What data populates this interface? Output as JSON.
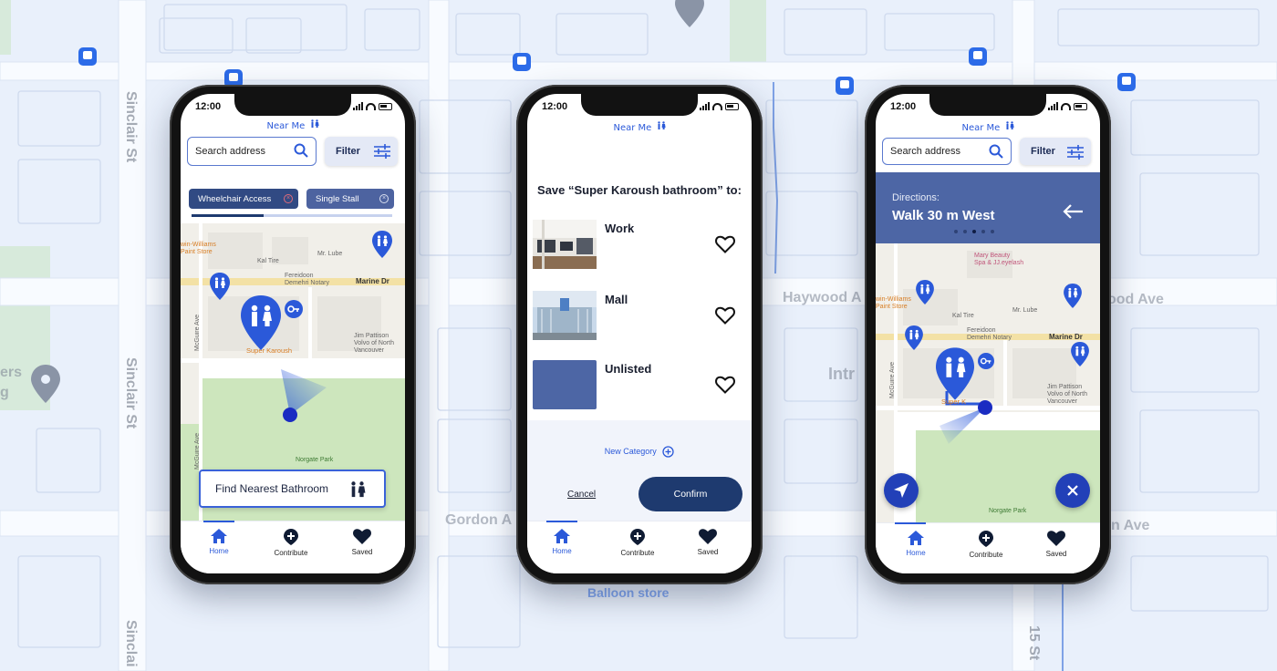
{
  "background": {
    "streets": [
      "Sinclair St",
      "Sinclair St",
      "Sinclai",
      "Haywood A",
      "ood Ave",
      "Gordon A",
      "n Ave",
      "Intr",
      "15 St",
      "ers",
      "g",
      "Balloon store"
    ]
  },
  "phone1": {
    "time": "12:00",
    "brand": "Near Me",
    "search_placeholder": "Search address",
    "filter_label": "Filter",
    "chips": [
      "Wheelchair Access",
      "Single Stall"
    ],
    "map_labels": {
      "store": "win-Williams\nPaint Store",
      "kaltire": "Kal Tire",
      "mrlube": "Mr. Lube",
      "notary": "Fereidoon\nDemehri Notary",
      "road": "Marine Dr",
      "mcguire": "McGuire Ave",
      "mcguire2": "McGuire Ave",
      "volvo": "Jim Pattison\nVolvo of North\nVancouver",
      "super": "Super Karoush",
      "park": "Norgate Park"
    },
    "find_button": "Find Nearest Bathroom",
    "nav": [
      "Home",
      "Contribute",
      "Saved"
    ]
  },
  "phone2": {
    "time": "12:00",
    "brand": "Near Me",
    "save_title": "Save “Super Karoush bathroom” to:",
    "categories": [
      "Work",
      "Mall",
      "Unlisted"
    ],
    "new_category": "New Category",
    "cancel": "Cancel",
    "confirm": "Confirm",
    "nav": [
      "Home",
      "Contribute",
      "Saved"
    ]
  },
  "phone3": {
    "time": "12:00",
    "brand": "Near Me",
    "search_placeholder": "Search address",
    "filter_label": "Filter",
    "directions_label": "Directions:",
    "directions_text": "Walk 30 m West",
    "map_labels": {
      "marybeauty": "Mary Beauty\nSpa & JJ.eyelash",
      "store": "win-Williams\nPaint Store",
      "kaltire": "Kal Tire",
      "mrlube": "Mr. Lube",
      "notary": "Fereidoon\nDemehri Notary",
      "road": "Marine Dr",
      "mcguire": "McGuire Ave",
      "volvo": "Jim Pattison\nVolvo of North\nVancouver",
      "super": "Super K",
      "park": "Norgate Park"
    },
    "nav": [
      "Home",
      "Contribute",
      "Saved"
    ]
  },
  "colors": {
    "accent": "#2b59d9",
    "navy": "#1e3a6f",
    "chip": "#314a83",
    "panel": "#4d66a5"
  },
  "icons": [
    "toilet-icon",
    "search-icon",
    "sliders-icon",
    "home-icon",
    "plus-circle-icon",
    "heart-icon",
    "key-icon",
    "navigation-arrow-icon",
    "close-icon",
    "back-arrow-icon"
  ]
}
